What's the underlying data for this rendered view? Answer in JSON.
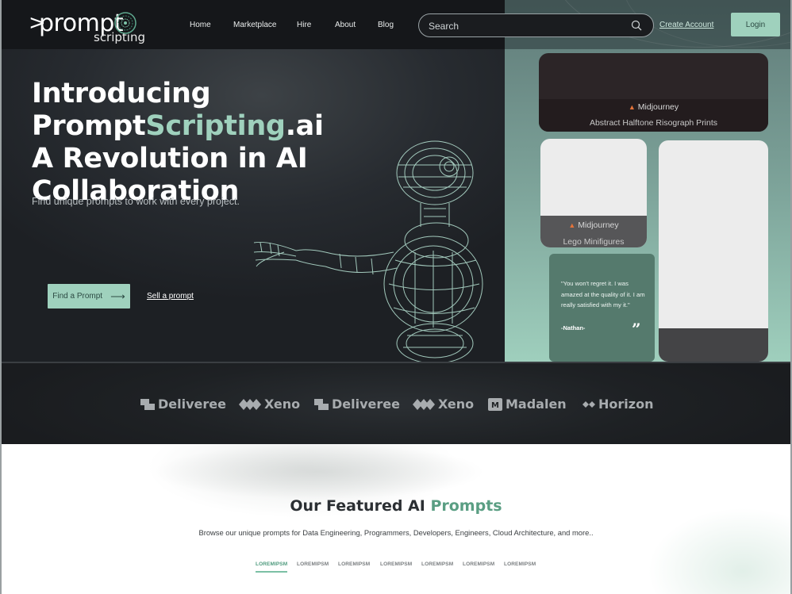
{
  "header": {
    "logo_prefix": ">",
    "logo_word": "prompt",
    "logo_sub": "scripting",
    "nav": [
      "Home",
      "Marketplace",
      "Hire",
      "About",
      "Blog"
    ],
    "search_placeholder": "Search",
    "create_account": "Create Account",
    "login": "Login"
  },
  "hero": {
    "headline_part1": "Introducing Prompt",
    "headline_accent": "Scripting",
    "headline_part2": ".ai",
    "headline_line2": "A Revolution in AI",
    "headline_line3": "Collaboration",
    "subtitle": "Find unique prompts to work with every project.",
    "find_button": "Find a Prompt",
    "sell_link": "Sell a prompt"
  },
  "cards": [
    {
      "model": "Midjourney",
      "title": "Abstract Halftone Risograph Prints"
    },
    {
      "model": "Midjourney",
      "title": "Lego Minifigures"
    }
  ],
  "testimonial": {
    "quote": "\"You won't regret it. I was amazed at the quality of it. I am really satisfied with my it.\"",
    "author": "-Nathan-",
    "mark": "”"
  },
  "brands": [
    "Deliveree",
    "Xeno",
    "Deliveree",
    "Xeno",
    "Madalen",
    "Horizon"
  ],
  "featured": {
    "title_part1": "Our Featured AI",
    "title_accent": "Prompts",
    "subtitle": "Browse our unique prompts for Data Engineering, Programmers, Developers, Engineers, Cloud Architecture, and more..",
    "tabs": [
      "LOREMIPSM",
      "LOREMIPSM",
      "LOREMIPSM",
      "LOREMIPSM",
      "LOREMIPSM",
      "LOREMIPSM",
      "LOREMIPSM"
    ],
    "active_tab": 0
  },
  "colors": {
    "accent": "#9fd1bd",
    "accent_dark": "#5a9e83",
    "hero_bg": "#272b30",
    "testimonial_bg": "#557a6d"
  },
  "icons": [
    "search-icon",
    "arrow-right-icon",
    "globe-logo-icon",
    "fire-icon",
    "quote-icon"
  ]
}
